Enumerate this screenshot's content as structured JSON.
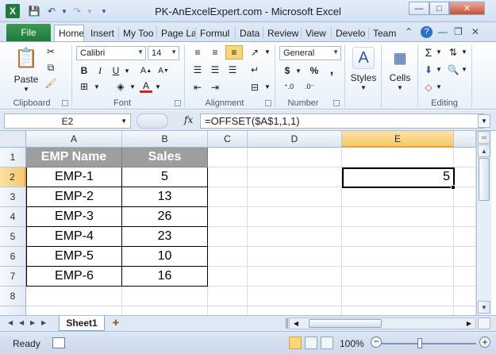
{
  "window": {
    "title": "PK-AnExcelExpert.com  -  Microsoft Excel",
    "app_icon": "X",
    "controls": {
      "minimize": "—",
      "maximize": "□",
      "close": "✕"
    }
  },
  "ribbon": {
    "file_tab": "File",
    "tabs": [
      "Home",
      "Insert",
      "My Too",
      "Page La",
      "Formul",
      "Data",
      "Review",
      "View",
      "Develo",
      "Team"
    ],
    "active_tab": "Home",
    "groups": {
      "clipboard": {
        "label": "Clipboard",
        "paste_label": "Paste"
      },
      "font": {
        "label": "Font",
        "font_name": "Calibri",
        "font_size": "14",
        "bold": "B",
        "italic": "I",
        "underline": "U"
      },
      "alignment": {
        "label": "Alignment"
      },
      "number": {
        "label": "Number",
        "format": "General",
        "currency": "$",
        "percent": "%",
        "comma": ","
      },
      "styles": {
        "label": "Styles"
      },
      "cells": {
        "label": "Cells"
      },
      "editing": {
        "label": "Editing"
      }
    }
  },
  "formula_bar": {
    "name_box": "E2",
    "fx_label": "fx",
    "formula": "=OFFSET($A$1,1,1)"
  },
  "sheet": {
    "columns": [
      "A",
      "B",
      "C",
      "D",
      "E"
    ],
    "selected_column": "E",
    "rows": [
      "1",
      "2",
      "3",
      "4",
      "5",
      "6",
      "7",
      "8"
    ],
    "selected_row": "2",
    "table_headers": [
      "EMP Name",
      "Sales"
    ],
    "table_rows": [
      [
        "EMP-1",
        "5"
      ],
      [
        "EMP-2",
        "13"
      ],
      [
        "EMP-3",
        "26"
      ],
      [
        "EMP-4",
        "23"
      ],
      [
        "EMP-5",
        "10"
      ],
      [
        "EMP-6",
        "16"
      ]
    ],
    "e2_value": "5"
  },
  "sheet_tabs": {
    "active": "Sheet1"
  },
  "status": {
    "text": "Ready",
    "zoom": "100%"
  },
  "colors": {
    "header_fill": "#9e9e9e",
    "file_tab": "#1f7a3c",
    "selection_header": "#f7c66b"
  }
}
